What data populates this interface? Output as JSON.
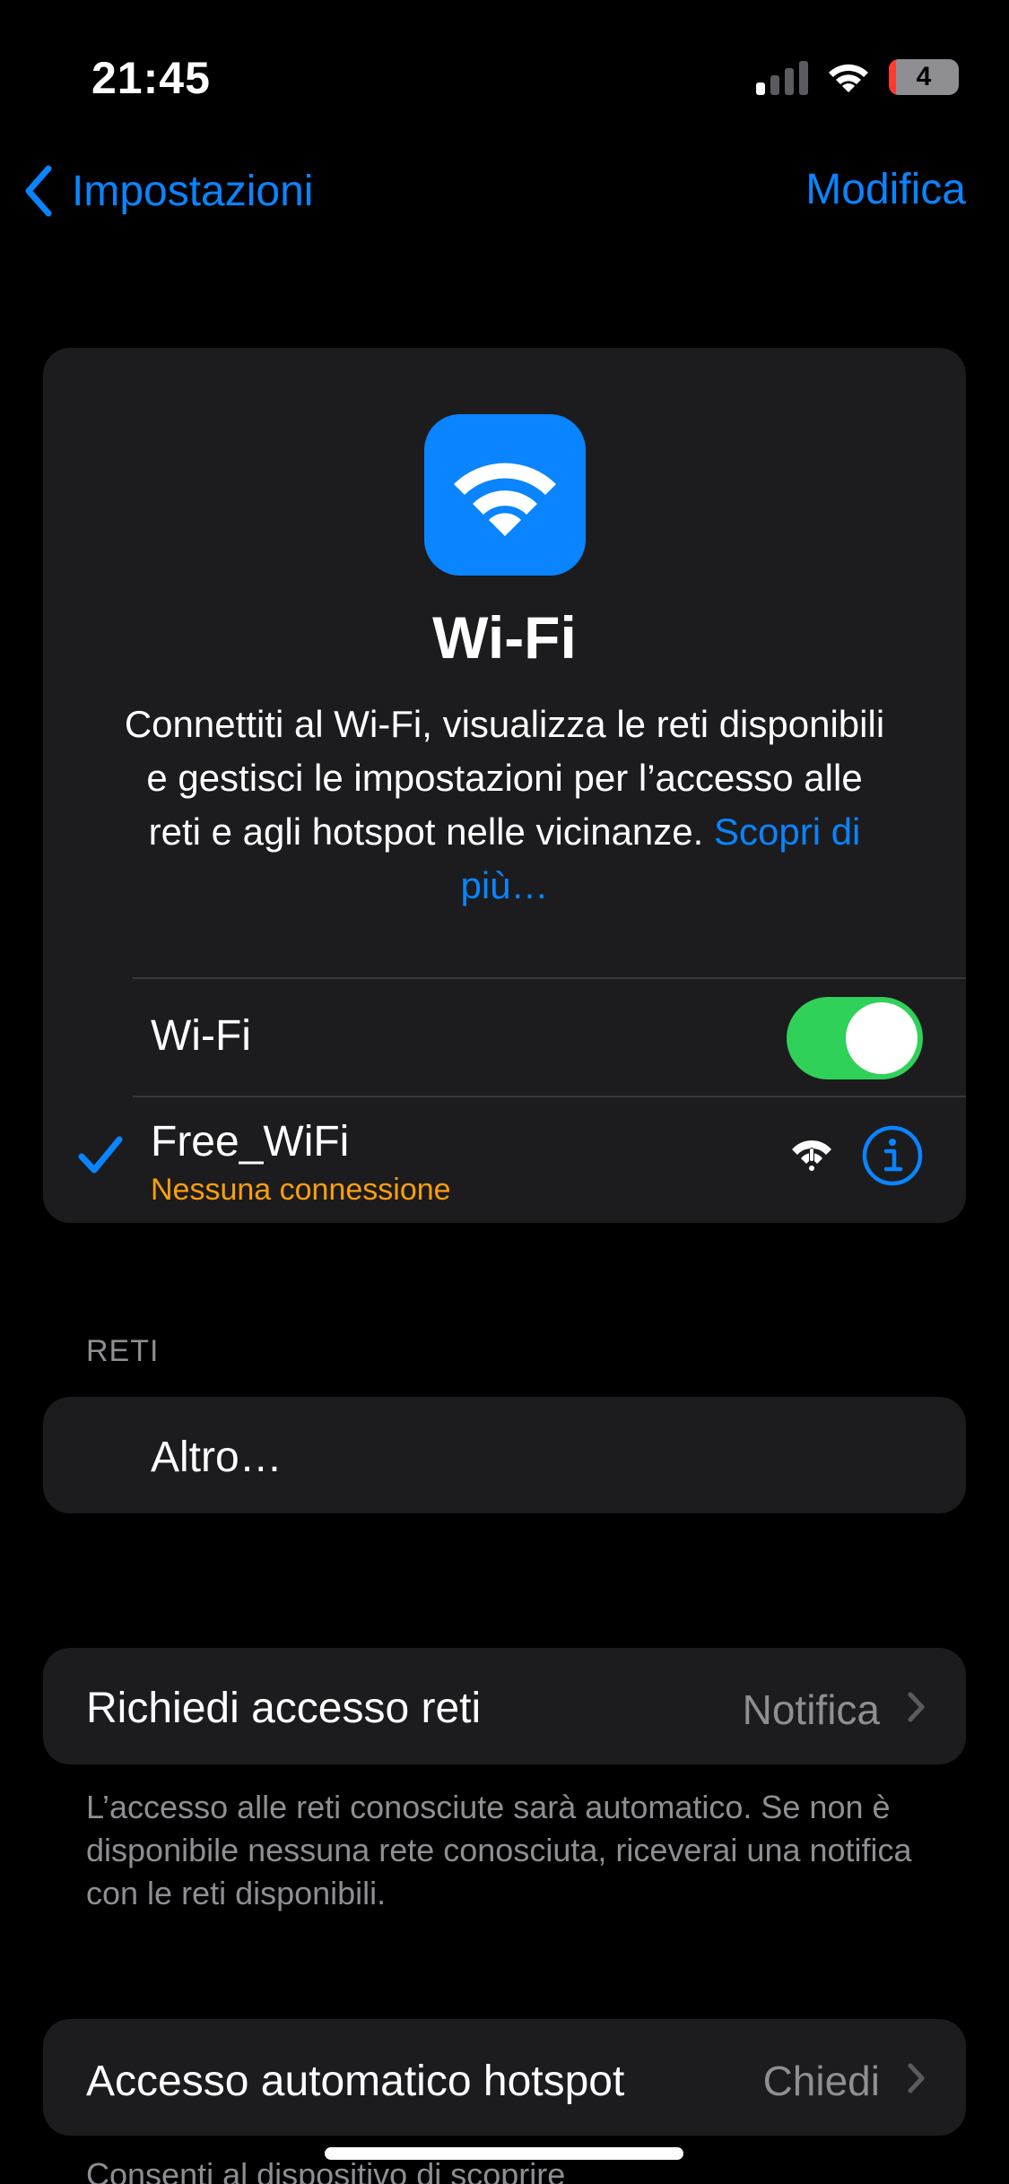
{
  "status": {
    "time": "21:45",
    "battery_level": "4"
  },
  "nav": {
    "back_label": "Impostazioni",
    "edit_label": "Modifica"
  },
  "hero": {
    "title": "Wi-Fi",
    "description": "Connettiti al Wi-Fi, visualizza le reti disponibili e gestisci le impostazioni per l’accesso alle reti e agli hotspot nelle vicinanze.",
    "learn_more": "Scopri di più…",
    "icon": "wifi-icon",
    "icon_color": "#0a84ff"
  },
  "wifi_row": {
    "label": "Wi-Fi",
    "enabled": true,
    "toggle_color": "#30d158"
  },
  "connected_network": {
    "name": "Free_WiFi",
    "status": "Nessuna connessione",
    "status_color": "#ff9f0a"
  },
  "networks_section": {
    "header": "RETI",
    "other_label": "Altro…"
  },
  "ask_to_join": {
    "label": "Richiedi accesso reti",
    "value": "Notifica",
    "note": "L’accesso alle reti conosciute sarà automatico. Se non è disponibile nessuna rete conosciuta, riceverai una notifica con le reti disponibili."
  },
  "auto_hotspot": {
    "label": "Accesso automatico hotspot",
    "value": "Chiedi",
    "note": "Consenti al dispositivo di scoprire"
  }
}
